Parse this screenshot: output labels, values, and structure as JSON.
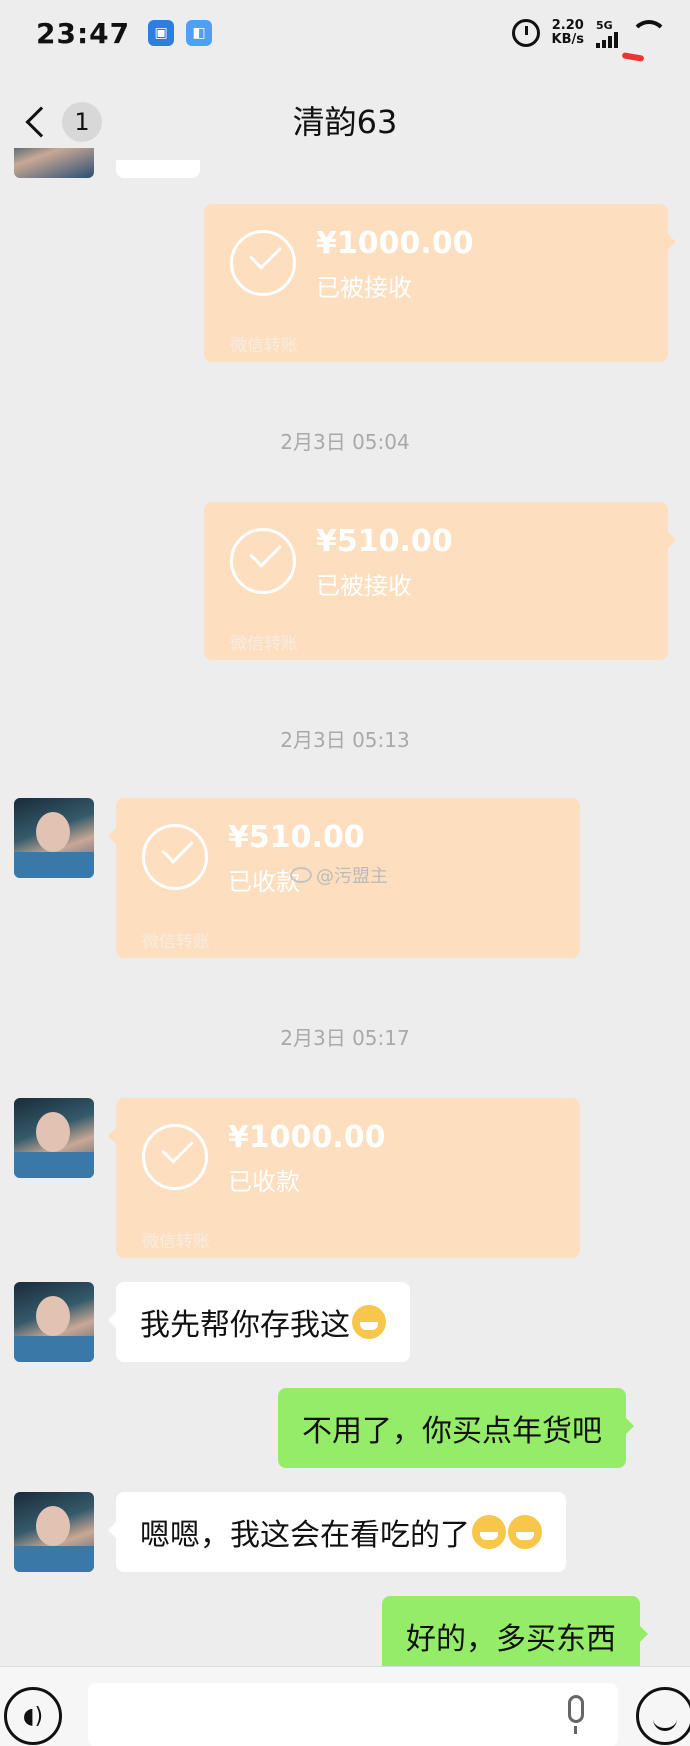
{
  "status_bar": {
    "time": "23:47",
    "net_speed_value": "2.20",
    "net_speed_unit": "KB/s",
    "network_type": "5G"
  },
  "nav": {
    "unread_count": "1",
    "title": "清韵63"
  },
  "messages": [
    {
      "type": "transfer",
      "direction": "out",
      "amount": "¥1000.00",
      "status": "已被接收",
      "footer": "微信转账"
    },
    {
      "type": "timestamp",
      "text": "2月3日 05:04"
    },
    {
      "type": "transfer",
      "direction": "out",
      "amount": "¥510.00",
      "status": "已被接收",
      "footer": "微信转账"
    },
    {
      "type": "timestamp",
      "text": "2月3日 05:13"
    },
    {
      "type": "transfer",
      "direction": "in",
      "amount": "¥510.00",
      "status": "已收款",
      "footer": "微信转账"
    },
    {
      "type": "timestamp",
      "text": "2月3日 05:17"
    },
    {
      "type": "transfer",
      "direction": "in",
      "amount": "¥1000.00",
      "status": "已收款",
      "footer": "微信转账"
    },
    {
      "type": "text",
      "direction": "in",
      "text": "我先帮你存我这",
      "emoji": "kissing-face-emoji"
    },
    {
      "type": "text",
      "direction": "out",
      "text": "不用了，你买点年货吧"
    },
    {
      "type": "text",
      "direction": "in",
      "text": "嗯嗯，我这会在看吃的了",
      "emoji": "grinning-face-emoji x2"
    },
    {
      "type": "text",
      "direction": "out",
      "text": "好的，多买东西"
    }
  ],
  "watermark": "@污盟主",
  "input_bar": {
    "voice_icon": "voice-icon",
    "mic_icon": "microphone-icon",
    "emoji_icon": "emoji-icon"
  }
}
